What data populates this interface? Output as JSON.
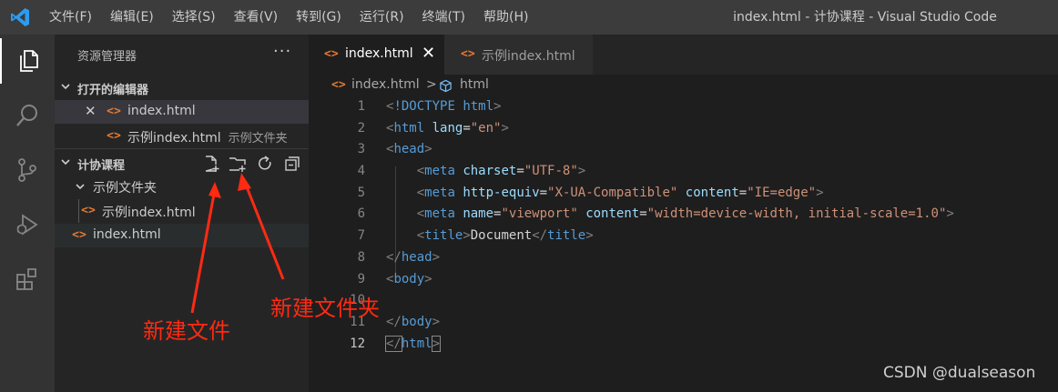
{
  "titlebar": {
    "menu": [
      "文件(F)",
      "编辑(E)",
      "选择(S)",
      "查看(V)",
      "转到(G)",
      "运行(R)",
      "终端(T)",
      "帮助(H)"
    ],
    "window_title": "index.html - 计协课程 - Visual Studio Code"
  },
  "activitybar": {
    "icons": [
      "explorer-icon",
      "search-icon",
      "source-control-icon",
      "run-debug-icon",
      "extensions-icon"
    ]
  },
  "sidebar": {
    "title": "资源管理器",
    "more": "···",
    "open_editors": {
      "label": "打开的编辑器",
      "items": [
        {
          "name": "index.html",
          "desc": ""
        },
        {
          "name": "示例index.html",
          "desc": "示例文件夹"
        }
      ]
    },
    "workspace": {
      "label": "计协课程",
      "folder": "示例文件夹",
      "folder_file": "示例index.html",
      "root_file": "index.html"
    },
    "file_icon": "<>"
  },
  "tabs": [
    {
      "label": "index.html",
      "active": true
    },
    {
      "label": "示例index.html",
      "active": false
    }
  ],
  "tab_close": "✕",
  "breadcrumb": {
    "file": "index.html",
    "separator": ">",
    "symbol": "html"
  },
  "editor": {
    "current_line": 12,
    "lines": [
      "<!DOCTYPE html>",
      "<html lang=\"en\">",
      "<head>",
      "    <meta charset=\"UTF-8\">",
      "    <meta http-equiv=\"X-UA-Compatible\" content=\"IE=edge\">",
      "    <meta name=\"viewport\" content=\"width=device-width, initial-scale=1.0\">",
      "    <title>Document</title>",
      "</head>",
      "<body>",
      "",
      "</body>",
      "</html>"
    ]
  },
  "annotations": {
    "new_file": "新建文件",
    "new_folder": "新建文件夹",
    "arrow_color": "#ff2a12"
  },
  "watermark": "CSDN @dualseason",
  "colors": {
    "accent_file_icon": "#e37933",
    "tag": "#569cd6",
    "attr": "#9cdcfe",
    "string": "#ce9178"
  }
}
